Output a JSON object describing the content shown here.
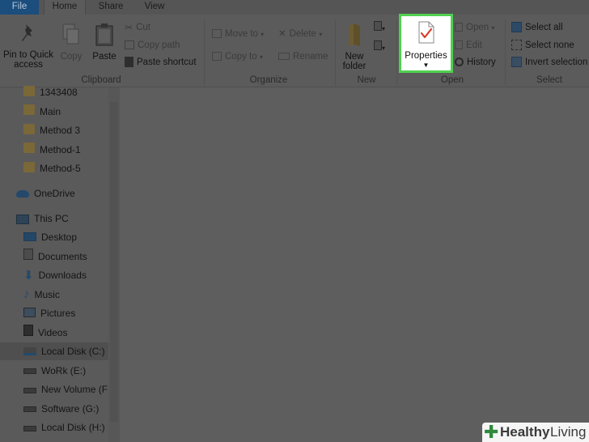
{
  "tabs": {
    "file": "File",
    "home": "Home",
    "share": "Share",
    "view": "View"
  },
  "ribbon": {
    "clipboard": {
      "label": "Clipboard",
      "pin": "Pin to Quick access",
      "copy": "Copy",
      "paste": "Paste",
      "cut": "Cut",
      "copy_path": "Copy path",
      "paste_shortcut": "Paste shortcut"
    },
    "organize": {
      "label": "Organize",
      "move_to": "Move to",
      "copy_to": "Copy to",
      "delete": "Delete",
      "rename": "Rename"
    },
    "new": {
      "label": "New",
      "new_folder": "New folder"
    },
    "open": {
      "label": "Open",
      "properties": "Properties",
      "open": "Open",
      "edit": "Edit",
      "history": "History"
    },
    "select": {
      "label": "Select",
      "select_all": "Select all",
      "select_none": "Select none",
      "invert_selection": "Invert selection"
    }
  },
  "nav": {
    "quick_access_items": [
      {
        "label": "1343408",
        "icon": "folder-icon",
        "pinned": true
      },
      {
        "label": "Main",
        "icon": "folder-icon"
      },
      {
        "label": "Method 3",
        "icon": "folder-icon"
      },
      {
        "label": "Method-1",
        "icon": "folder-icon"
      },
      {
        "label": "Method-5",
        "icon": "folder-icon"
      }
    ],
    "onedrive": "OneDrive",
    "this_pc": "This PC",
    "pc_items": [
      {
        "label": "Desktop",
        "icon": "desktop-icon"
      },
      {
        "label": "Documents",
        "icon": "documents-icon"
      },
      {
        "label": "Downloads",
        "icon": "downloads-icon"
      },
      {
        "label": "Music",
        "icon": "music-icon"
      },
      {
        "label": "Pictures",
        "icon": "pictures-icon"
      },
      {
        "label": "Videos",
        "icon": "videos-icon"
      },
      {
        "label": "Local Disk (C:)",
        "icon": "system-drive-icon",
        "selected": true
      },
      {
        "label": "WoRk (E:)",
        "icon": "drive-icon"
      },
      {
        "label": "New Volume (F:)",
        "icon": "drive-icon"
      },
      {
        "label": "Software (G:)",
        "icon": "drive-icon"
      },
      {
        "label": "Local Disk (H:)",
        "icon": "drive-icon"
      }
    ]
  },
  "watermark": {
    "word1": "Healthy",
    "word2": "Living"
  },
  "colors": {
    "highlight_border": "#4fd04f",
    "file_tab": "#1b4d7d",
    "overlay": "#5a5a5a"
  }
}
